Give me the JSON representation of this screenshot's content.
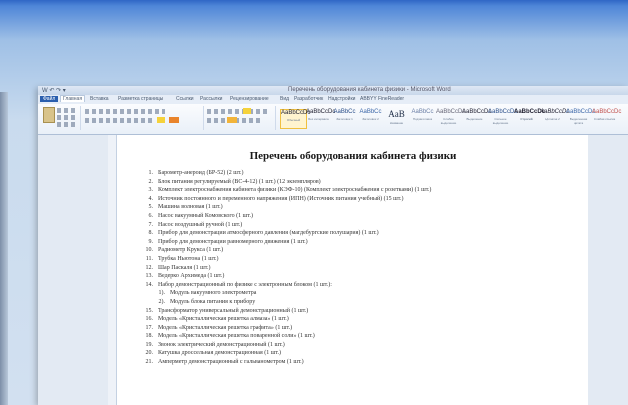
{
  "window": {
    "title": "Перечень оборудования кабинета физики - Microsoft Word",
    "qat_text": "W ↶ ↷ ▾"
  },
  "tabs": [
    "Файл",
    "Главная",
    "Вставка",
    "Разметка страницы",
    "Ссылки",
    "Рассылки",
    "Рецензирование",
    "Вид",
    "Разработчик",
    "Надстройки",
    "ABBYY FineReader"
  ],
  "ribbon": {
    "styles": [
      {
        "sample": "AaBbCcDc",
        "name": "Обычный"
      },
      {
        "sample": "AaBbCcDc",
        "name": "Без интервала"
      },
      {
        "sample": "AaBbCc",
        "name": "Заголовок 1"
      },
      {
        "sample": "AaBbCc",
        "name": "Заголовок 2"
      },
      {
        "sample": "AaB",
        "name": "Название"
      },
      {
        "sample": "AaBbCc",
        "name": "Подзаголовок"
      },
      {
        "sample": "AaBbCcDc",
        "name": "Слабое выделение"
      },
      {
        "sample": "AaBbCcDc",
        "name": "Выделение"
      },
      {
        "sample": "AaBbCcDc",
        "name": "Сильное выделение"
      },
      {
        "sample": "AaBbCcDc",
        "name": "Строгий"
      },
      {
        "sample": "AaBbCcDc",
        "name": "Цитата 2"
      },
      {
        "sample": "AaBbCcDc",
        "name": "Выделенная цитата"
      },
      {
        "sample": "AaBbCcDc",
        "name": "Слабая ссылка"
      }
    ]
  },
  "document": {
    "title": "Перечень оборудования кабинета физики",
    "items": [
      {
        "n": "1.",
        "text": "Барометр-анероид (БР-52) (2 шт.)"
      },
      {
        "n": "2.",
        "text": "Блок питания регулируемый (ВС-4-12) (1 шт.) (12 экземпляров)"
      },
      {
        "n": "3.",
        "text": "Комплект электроснабжения кабинета физики (КЭФ-10) (Комплект электроснабжения с розетками) (1 шт.)"
      },
      {
        "n": "4.",
        "text": "Источник постоянного и переменного напряжения (ИПН) (Источник питания учебный) (15 шт.)"
      },
      {
        "n": "5.",
        "text": "Машина волновая (1 шт.)"
      },
      {
        "n": "6.",
        "text": "Насос вакуумный Комовского (1 шт.)"
      },
      {
        "n": "7.",
        "text": "Насос воздушный ручной (1 шт.)"
      },
      {
        "n": "8.",
        "text": "Прибор для демонстрации атмосферного давления (магдебургские полушария) (1 шт.)"
      },
      {
        "n": "9.",
        "text": "Прибор для демонстрации равномерного движения (1 шт.)"
      },
      {
        "n": "10.",
        "text": "Радиометр Крукса (1 шт.)"
      },
      {
        "n": "11.",
        "text": "Трубка Ньютона (1 шт.)"
      },
      {
        "n": "12.",
        "text": "Шар Паскаля (1 шт.)"
      },
      {
        "n": "13.",
        "text": "Ведерко Архимеда (1 шт.)"
      },
      {
        "n": "14.",
        "text": "Набор демонстрационный по физике с электронным блоком (1 шт.):"
      },
      {
        "n": "1).",
        "text": "Модуль вакуумного электрометра",
        "sub": true
      },
      {
        "n": "2).",
        "text": "Модуль блока питания к прибору",
        "sub": true
      },
      {
        "n": "15.",
        "text": "Трансформатор универсальный демонстрационный (1 шт.)"
      },
      {
        "n": "16.",
        "text": "Модель «Кристаллическая решетка алмаза» (1 шт.)"
      },
      {
        "n": "17.",
        "text": "Модель «Кристаллическая решетка графита» (1 шт.)"
      },
      {
        "n": "18.",
        "text": "Модель «Кристаллическая решетка поваренной соли» (1 шт.)"
      },
      {
        "n": "19.",
        "text": "Звонок электрический демонстрационный (1 шт.)"
      },
      {
        "n": "20.",
        "text": "Катушка дроссельная демонстрационная (1 шт.)"
      },
      {
        "n": "21.",
        "text": "Амперметр демонстрационный с гальванометром (1 шт.)"
      }
    ]
  }
}
